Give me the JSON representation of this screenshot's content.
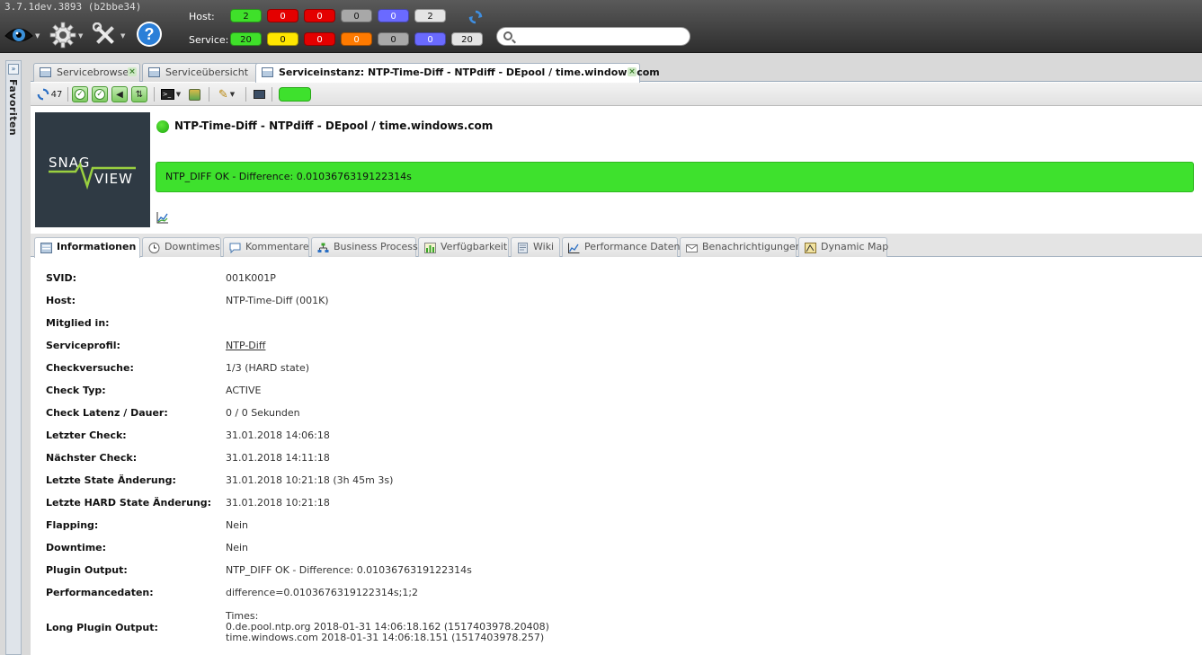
{
  "app": {
    "version": "3.7.1dev.3893 (b2bbe34)"
  },
  "icons": {
    "eye": "eye-icon",
    "settings": "gear-icon",
    "tools": "tools-icon",
    "help": "help-icon",
    "refresh": "refresh-icon",
    "search": "search-icon"
  },
  "status_bar": {
    "host_label": "Host:",
    "service_label": "Service:",
    "host_counts": [
      {
        "value": "2",
        "color": "#3fe02a",
        "text": "#111"
      },
      {
        "value": "0",
        "color": "#e40000",
        "text": "#fff"
      },
      {
        "value": "0",
        "color": "#e40000",
        "text": "#fff"
      },
      {
        "value": "0",
        "color": "#a8a8a8",
        "text": "#111"
      },
      {
        "value": "0",
        "color": "#6a6aff",
        "text": "#fff"
      },
      {
        "value": "2",
        "color": "#e4e4e4",
        "text": "#111"
      }
    ],
    "service_counts": [
      {
        "value": "20",
        "color": "#3fe02a",
        "text": "#111"
      },
      {
        "value": "0",
        "color": "#ffe600",
        "text": "#111"
      },
      {
        "value": "0",
        "color": "#e40000",
        "text": "#fff"
      },
      {
        "value": "0",
        "color": "#ff7a00",
        "text": "#fff"
      },
      {
        "value": "0",
        "color": "#a8a8a8",
        "text": "#111"
      },
      {
        "value": "0",
        "color": "#6a6aff",
        "text": "#fff"
      },
      {
        "value": "20",
        "color": "#e4e4e4",
        "text": "#111"
      }
    ]
  },
  "search": {
    "placeholder": "",
    "value": ""
  },
  "favorites": {
    "label": "Favoriten",
    "toggle": "»"
  },
  "tabs": [
    {
      "label": "Servicebrowser",
      "active": false
    },
    {
      "label": "Serviceübersicht",
      "active": false
    },
    {
      "label": "Serviceinstanz: NTP-Time-Diff - NTPdiff - DEpool / time.windows.com",
      "active": true
    }
  ],
  "toolbar": {
    "refresh_count": "47"
  },
  "service": {
    "title": "NTP-Time-Diff - NTPdiff - DEpool / time.windows.com",
    "status_color": "#3ee12d",
    "output": "NTP_DIFF OK - Difference: 0.0103676319122314s",
    "logo_text_top": "SNAG",
    "logo_text_bottom": "VIEW"
  },
  "detail_tabs": [
    {
      "label": "Informationen",
      "icon": "info-icon",
      "active": true
    },
    {
      "label": "Downtimes",
      "icon": "clock-icon",
      "active": false
    },
    {
      "label": "Kommentare",
      "icon": "comment-icon",
      "active": false
    },
    {
      "label": "Business Process",
      "icon": "hierarchy-icon",
      "active": false
    },
    {
      "label": "Verfügbarkeit",
      "icon": "bar-chart-icon",
      "active": false
    },
    {
      "label": "Wiki",
      "icon": "wiki-icon",
      "active": false
    },
    {
      "label": "Performance Daten",
      "icon": "line-chart-icon",
      "active": false
    },
    {
      "label": "Benachrichtigungen",
      "icon": "mail-icon",
      "active": false
    },
    {
      "label": "Dynamic Map",
      "icon": "map-icon",
      "active": false
    }
  ],
  "info": {
    "rows": [
      {
        "label": "SVID:",
        "value": "001K001P"
      },
      {
        "label": "Host:",
        "value": "NTP-Time-Diff (001K)"
      },
      {
        "label": "Mitglied in:",
        "value": ""
      },
      {
        "label": "Serviceprofil:",
        "value": "NTP-Diff",
        "link": true
      },
      {
        "label": "Checkversuche:",
        "value": "1/3 (HARD state)"
      },
      {
        "label": "Check Typ:",
        "value": "ACTIVE"
      },
      {
        "label": "Check Latenz / Dauer:",
        "value": "0 / 0 Sekunden"
      },
      {
        "label": "Letzter Check:",
        "value": "31.01.2018 14:06:18"
      },
      {
        "label": "Nächster Check:",
        "value": "31.01.2018 14:11:18"
      },
      {
        "label": "Letzte State Änderung:",
        "value": "31.01.2018 10:21:18 (3h 45m 3s)"
      },
      {
        "label": "Letzte HARD State Änderung:",
        "value": "31.01.2018 10:21:18"
      },
      {
        "label": "Flapping:",
        "value": "Nein"
      },
      {
        "label": "Downtime:",
        "value": "Nein"
      },
      {
        "label": "Plugin Output:",
        "value": "NTP_DIFF OK - Difference: 0.0103676319122314s"
      },
      {
        "label": "Performancedaten:",
        "value": "difference=0.0103676319122314s;1;2"
      }
    ],
    "long_output": {
      "label": "Long Plugin Output:",
      "lines": [
        "Times:",
        "0.de.pool.ntp.org 2018-01-31 14:06:18.162 (1517403978.20408)",
        "time.windows.com 2018-01-31 14:06:18.151 (1517403978.257)"
      ]
    }
  }
}
